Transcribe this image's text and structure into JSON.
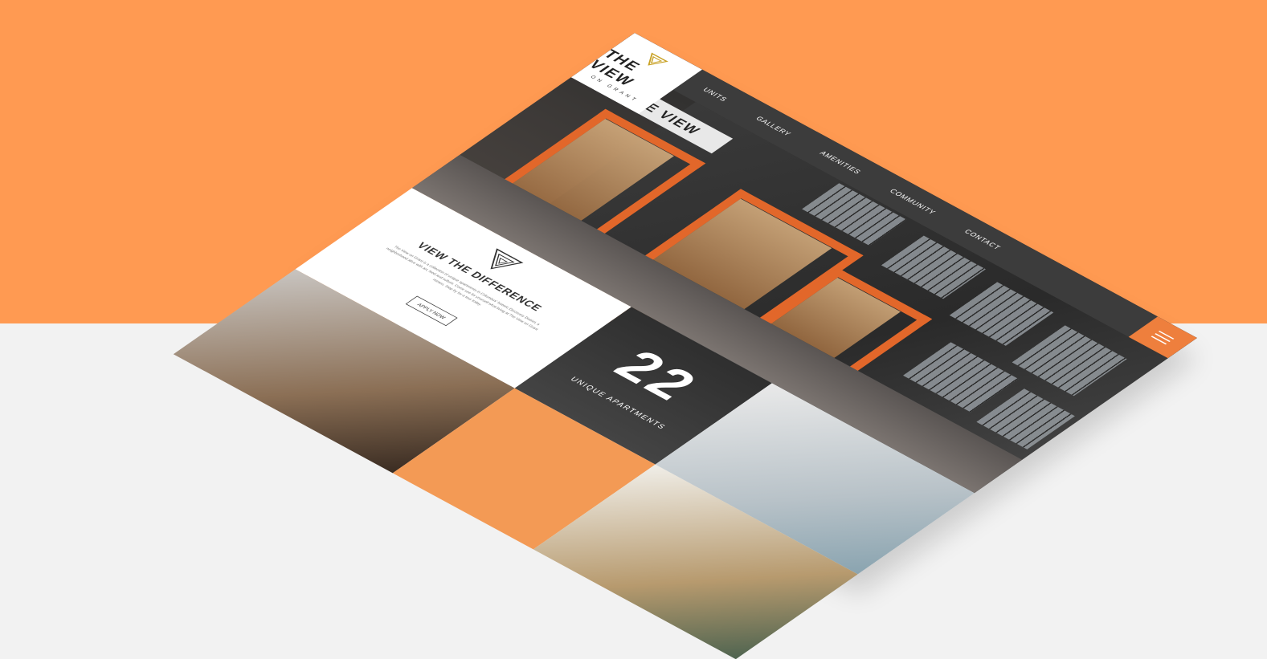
{
  "brand": {
    "name": "THE VIEW",
    "tagline": "ON GRANT",
    "sign_text": "THE VIEW"
  },
  "nav": {
    "items": [
      "UNITS",
      "GALLERY",
      "AMENITIES",
      "COMMUNITY",
      "CONTACT"
    ]
  },
  "intro": {
    "heading": "VIEW THE DIFFERENCE",
    "body": "The View on Grant is a collection of unique apartments in Columbus' historic Discovery District, a neighborhood alive with art, food and culture. Come see for yourself what living at The View on Grant means. Stop by for a tour today.",
    "cta": "APPLY NOW"
  },
  "stat": {
    "number": "22",
    "label": "UNIQUE APARTMENTS"
  },
  "colors": {
    "accent": "#EE7F3D",
    "background_top": "#FF9A52",
    "background_bottom": "#f2f2f2",
    "nav_bg": "#3c3c3c"
  }
}
